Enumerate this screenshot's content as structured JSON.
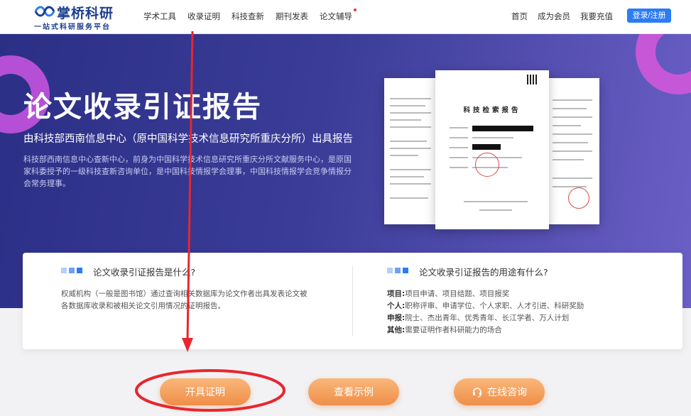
{
  "header": {
    "logo_name": "掌桥科研",
    "logo_slogan": "一站式科研服务平台",
    "nav": [
      {
        "label": "学术工具"
      },
      {
        "label": "收录证明"
      },
      {
        "label": "科技查新"
      },
      {
        "label": "期刊发表"
      },
      {
        "label": "论文辅导"
      }
    ],
    "right_links": [
      {
        "label": "首页"
      },
      {
        "label": "成为会员"
      },
      {
        "label": "我要充值"
      }
    ],
    "login_label": "登录/注册"
  },
  "hero": {
    "title": "论文收录引证报告",
    "subtitle": "由科技部西南信息中心（原中国科学技术信息研究所重庆分所）出具报告",
    "description": "科技部西南信息中心查新中心，前身为中国科学技术信息研究所重庆分所文献服务中心，是原国家科委授予的一级科技查新咨询单位，是中国科技情报学会理事，中国科技情报学会竞争情报分会常务理事。",
    "doc_title": "科技检索报告"
  },
  "info": {
    "what_title": "论文收录引证报告是什么?",
    "what_text": "权威机构（一般是图书馆）通过查询相关数据库为论文作者出具发表论文被各数据库收录和被相关论文引用情况的证明报告。",
    "uses_title": "论文收录引证报告的用途有什么?",
    "uses": [
      {
        "key": "项目:",
        "value": "项目申请、项目结题、项目报奖"
      },
      {
        "key": "个人:",
        "value": "职称评审、申请学位、个人求职、人才引进、科研奖励"
      },
      {
        "key": "申报:",
        "value": "院士、杰出青年、优秀青年、长江学者、万人计划"
      },
      {
        "key": "其他:",
        "value": "需要证明作者科研能力的场合"
      }
    ]
  },
  "actions": {
    "issue_label": "开具证明",
    "example_label": "查看示例",
    "consult_label": "在线咨询"
  },
  "icons": {
    "logo": "logo-wave-icon",
    "consult": "headset-icon",
    "nav_badge": "red-dot-icon"
  },
  "colors": {
    "brand": "#1d3f8f",
    "accent": "#2c7cf5",
    "orange": "#ef8e48",
    "annotation": "#e8262e"
  }
}
